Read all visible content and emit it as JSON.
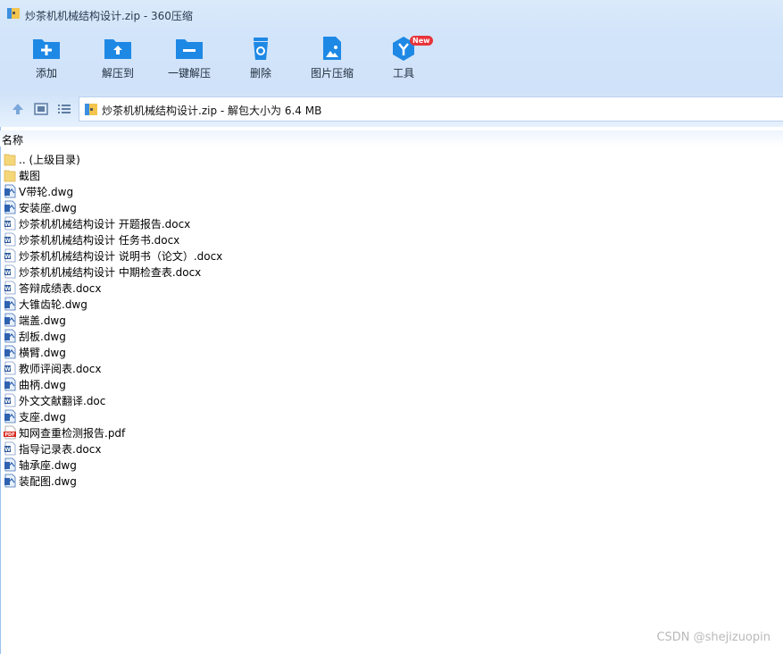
{
  "window": {
    "title": "炒茶机机械结构设计.zip - 360压缩"
  },
  "toolbar": {
    "add_label": "添加",
    "extract_to_label": "解压到",
    "one_click_extract_label": "一键解压",
    "delete_label": "删除",
    "image_compress_label": "图片压缩",
    "tools_label": "工具",
    "new_badge": "New"
  },
  "address": {
    "text": "炒茶机机械结构设计.zip - 解包大小为 6.4 MB"
  },
  "list": {
    "column_name": "名称",
    "items": [
      {
        "name": ".. (上级目录)",
        "type": "folder"
      },
      {
        "name": "截图",
        "type": "folder"
      },
      {
        "name": "V带轮.dwg",
        "type": "dwg"
      },
      {
        "name": "安装座.dwg",
        "type": "dwg"
      },
      {
        "name": "炒茶机机械结构设计 开题报告.docx",
        "type": "docx"
      },
      {
        "name": "炒茶机机械结构设计 任务书.docx",
        "type": "docx"
      },
      {
        "name": "炒茶机机械结构设计 说明书（论文）.docx",
        "type": "docx"
      },
      {
        "name": "炒茶机机械结构设计 中期检查表.docx",
        "type": "docx"
      },
      {
        "name": "答辩成绩表.docx",
        "type": "docx"
      },
      {
        "name": "大锥齿轮.dwg",
        "type": "dwg"
      },
      {
        "name": "端盖.dwg",
        "type": "dwg"
      },
      {
        "name": "刮板.dwg",
        "type": "dwg"
      },
      {
        "name": "横臂.dwg",
        "type": "dwg"
      },
      {
        "name": "教师评阅表.docx",
        "type": "docx"
      },
      {
        "name": "曲柄.dwg",
        "type": "dwg"
      },
      {
        "name": "外文文献翻译.doc",
        "type": "doc"
      },
      {
        "name": "支座.dwg",
        "type": "dwg"
      },
      {
        "name": "知网查重检测报告.pdf",
        "type": "pdf"
      },
      {
        "name": "指导记录表.docx",
        "type": "docx"
      },
      {
        "name": "轴承座.dwg",
        "type": "dwg"
      },
      {
        "name": "装配图.dwg",
        "type": "dwg"
      }
    ]
  },
  "watermark": "CSDN @shejizuopin",
  "colors": {
    "toolbar_icon": "#1e88e5",
    "folder": "#f5d77a",
    "pdf": "#d9261c",
    "word": "#2b579a"
  }
}
